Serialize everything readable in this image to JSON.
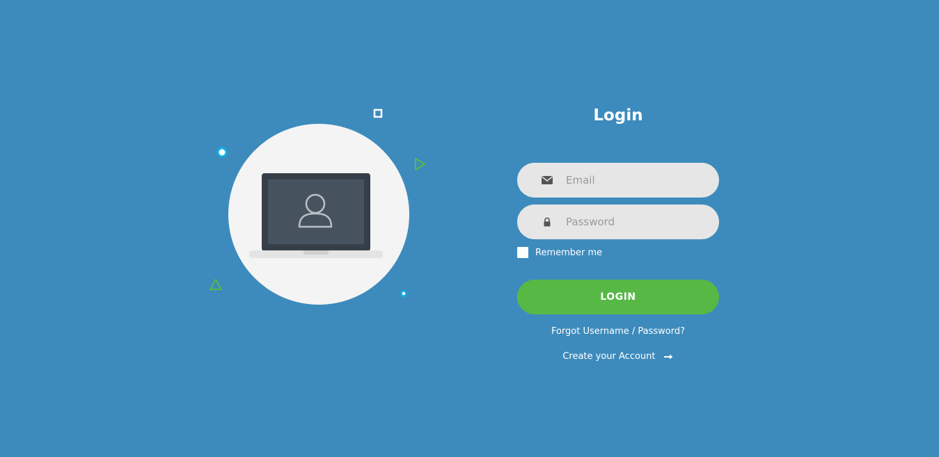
{
  "colors": {
    "background": "#3d8bbd",
    "accent_green": "#57b846",
    "field_bg": "#e6e6e6",
    "circle_bg": "#f4f4f4",
    "laptop_dark": "#363f48",
    "screen": "#46535f",
    "deco_cyan": "#0fb2e6",
    "deco_green": "#57b846"
  },
  "illustration": {
    "circle_icon": "laptop-user-icon",
    "decorations": [
      "ring-dot-icon",
      "square-outline-icon",
      "play-triangle-icon",
      "triangle-outline-icon",
      "small-dot-icon"
    ]
  },
  "form": {
    "title": "Login",
    "email": {
      "placeholder": "Email",
      "value": "",
      "icon": "envelope-icon"
    },
    "password": {
      "placeholder": "Password",
      "value": "",
      "icon": "lock-icon"
    },
    "remember_label": "Remember me",
    "remember_checked": false,
    "login_label": "LOGIN",
    "forgot_label": "Forgot Username / Password?",
    "create_label": "Create your Account",
    "create_icon": "long-arrow-right-icon"
  }
}
